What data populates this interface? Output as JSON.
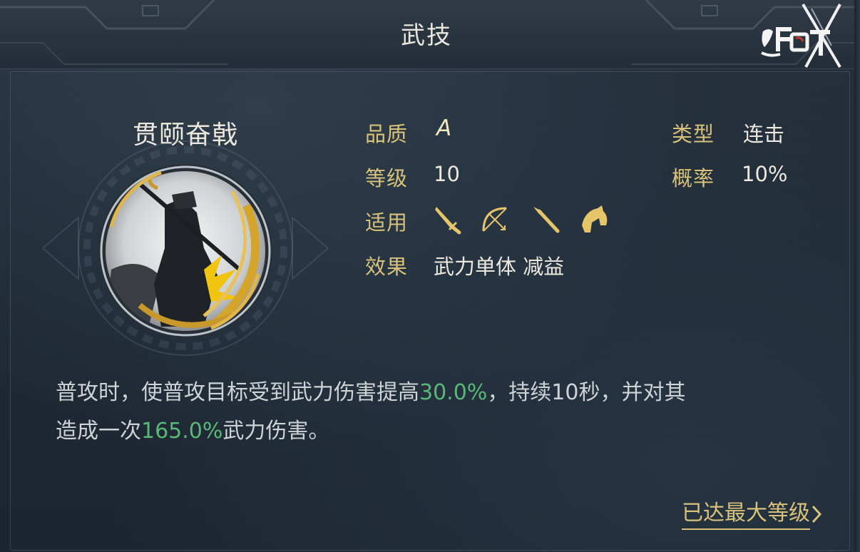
{
  "header": {
    "title": "武技"
  },
  "logo": {
    "icon": "game-logo-icon"
  },
  "skill": {
    "name": "贯颐奋戟",
    "portrait_icon": "warrior-portrait-icon",
    "attributes": {
      "quality_label": "品质",
      "quality_value": "A",
      "level_label": "等级",
      "level_value": "10",
      "applicable_label": "适用",
      "applicable_icons": [
        "sword-icon",
        "bow-icon",
        "spear-icon",
        "horse-icon"
      ],
      "effect_label": "效果",
      "effect_value": "武力单体 减益",
      "type_label": "类型",
      "type_value": "连击",
      "chance_label": "概率",
      "chance_value": "10%"
    },
    "description": {
      "line1_part1": "普攻时，使普攻目标受到武力伤害提高",
      "line1_highlight": "30.0%",
      "line1_part2": "，持续10秒，并对其",
      "line2_part1": "造成一次",
      "line2_highlight": "165.0%",
      "line2_part2": "武力伤害。"
    }
  },
  "footer": {
    "max_level_label": "已达最大等级"
  },
  "colors": {
    "gold": "#d8c27a",
    "highlight_green": "#58b877",
    "text_light": "#ece8de",
    "background": "#1f2a35"
  }
}
